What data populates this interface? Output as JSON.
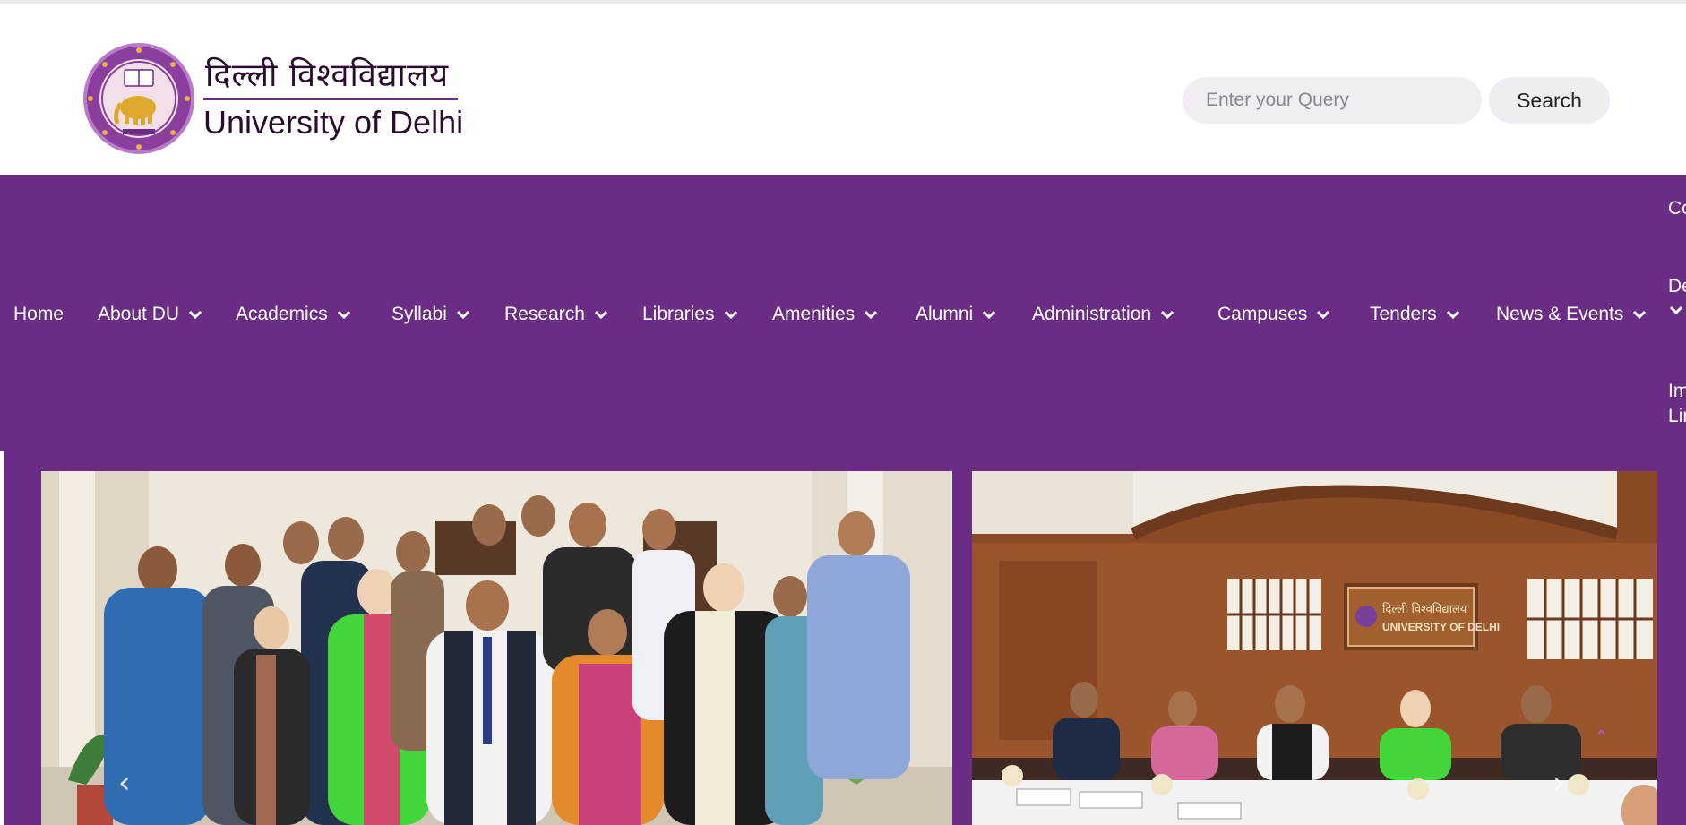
{
  "header": {
    "logo_hindi": "दिल्ली विश्वविद्यालय",
    "logo_english": "University of Delhi",
    "seal_alt": "University of Delhi seal"
  },
  "search": {
    "placeholder": "Enter your Query",
    "value": "",
    "button_label": "Search"
  },
  "nav": {
    "items": [
      {
        "label": "Home",
        "dropdown": false
      },
      {
        "label": "About DU",
        "dropdown": true
      },
      {
        "label": "Academics",
        "dropdown": true
      },
      {
        "label": "Syllabi",
        "dropdown": true
      },
      {
        "label": "Research",
        "dropdown": true
      },
      {
        "label": "Libraries",
        "dropdown": true
      },
      {
        "label": "Amenities",
        "dropdown": true
      },
      {
        "label": "Alumni",
        "dropdown": true
      },
      {
        "label": "Administration",
        "dropdown": true
      },
      {
        "label": "Campuses",
        "dropdown": true
      },
      {
        "label": "Tenders",
        "dropdown": true
      },
      {
        "label": "News & Events",
        "dropdown": true
      }
    ],
    "overflow_items": [
      "Co",
      "De",
      "Im",
      "Lir"
    ]
  },
  "slider": {
    "slides": [
      {
        "caption": "Group photo of university officials and visiting delegation"
      },
      {
        "caption": "Meeting in the University of Delhi conference hall"
      }
    ],
    "prev_icon": "chevron-left-icon",
    "next_icon": "chevron-right-icon",
    "banner_text": [
      "दिल्ली विश्वविद्यालय",
      "UNIVERSITY OF DELHI"
    ]
  },
  "colors": {
    "brand_purple": "#6a2c85",
    "search_bg": "#f1edf3",
    "text_dark": "#2a0d2e"
  }
}
